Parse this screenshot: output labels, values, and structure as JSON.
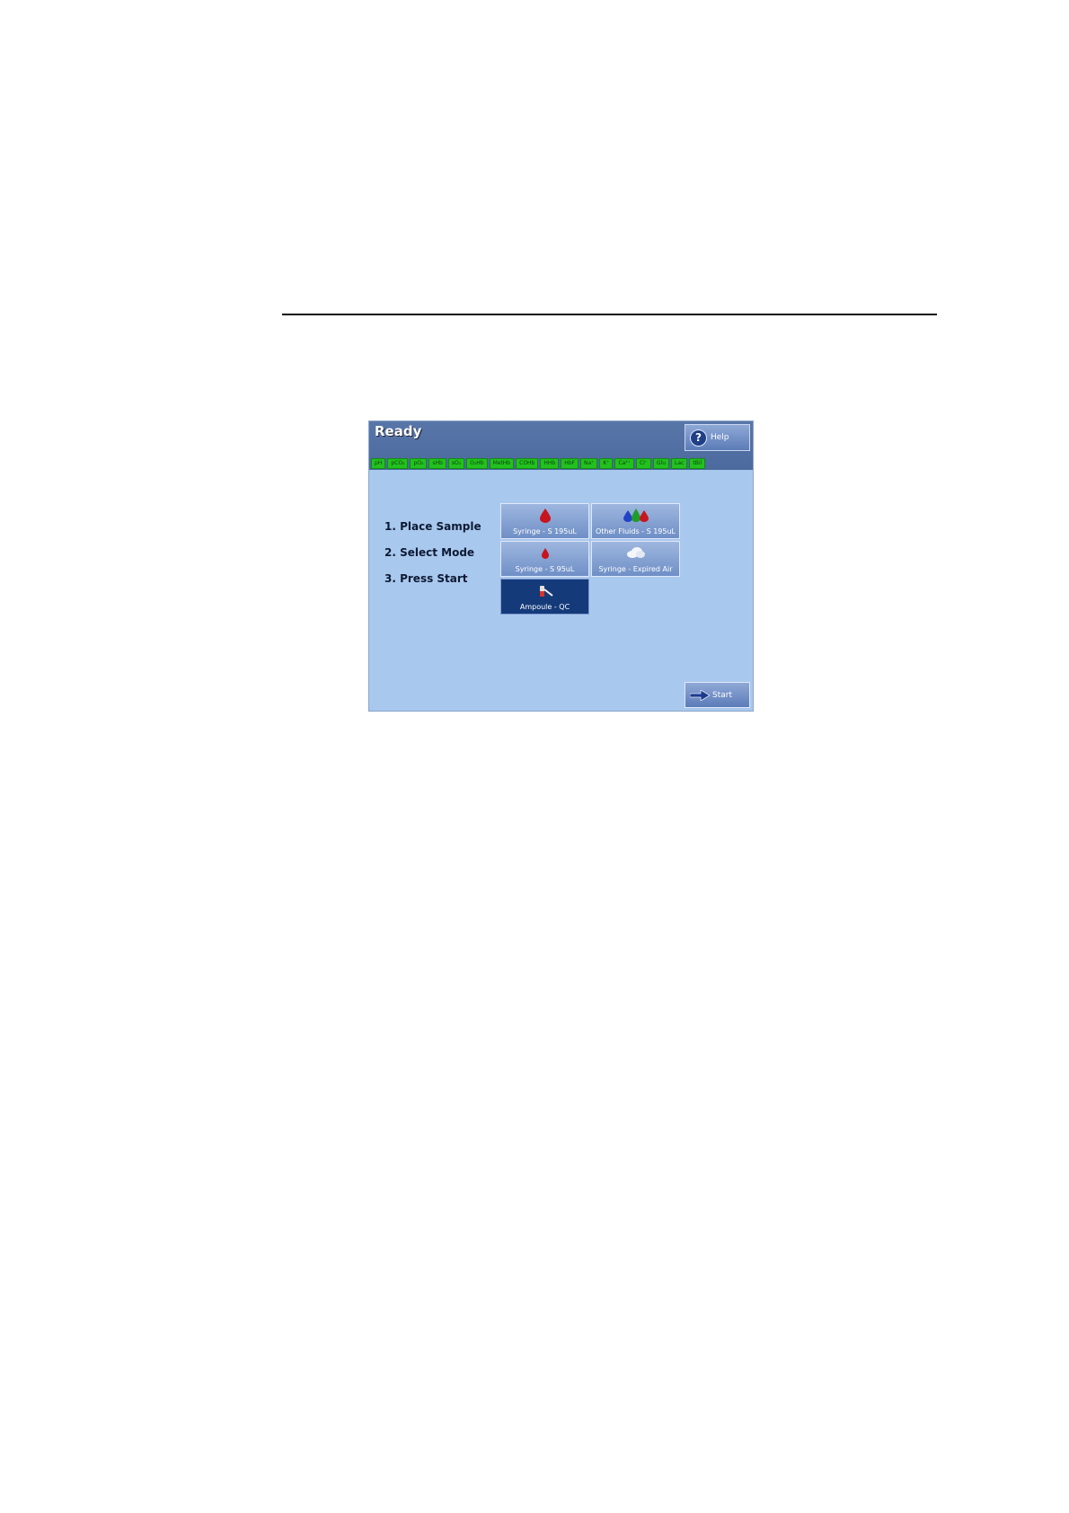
{
  "screen": {
    "title": "Ready",
    "help_label": "Help",
    "start_label": "Start"
  },
  "parameters": [
    "pH",
    "pCO₂",
    "pO₂",
    "sHb",
    "sO₂",
    "O₂Hb",
    "MetHb",
    "COHb",
    "HHb",
    "HbF",
    "Na⁺",
    "K⁺",
    "Ca²⁺",
    "Cl⁻",
    "Glu",
    "Lac",
    "tBil"
  ],
  "steps": [
    "1. Place Sample",
    "2. Select Mode",
    "3. Press Start"
  ],
  "modes": [
    {
      "label": "Syringe - S 195uL",
      "icon": "blood-drop-icon",
      "selected": false
    },
    {
      "label": "Other Fluids - S 195uL",
      "icon": "multi-drop-icon",
      "selected": false
    },
    {
      "label": "Syringe - S 95uL",
      "icon": "small-blood-drop-icon",
      "selected": false
    },
    {
      "label": "Syringe - Expired Air",
      "icon": "cloud-icon",
      "selected": false
    },
    {
      "label": "Ampoule - QC",
      "icon": "ampoule-icon",
      "selected": true
    }
  ],
  "colors": {
    "param_ok": "#23c11f",
    "title_bar": "#4c6a9e",
    "screen_bg": "#a9c8ee",
    "selected_mode": "#143a7a"
  }
}
